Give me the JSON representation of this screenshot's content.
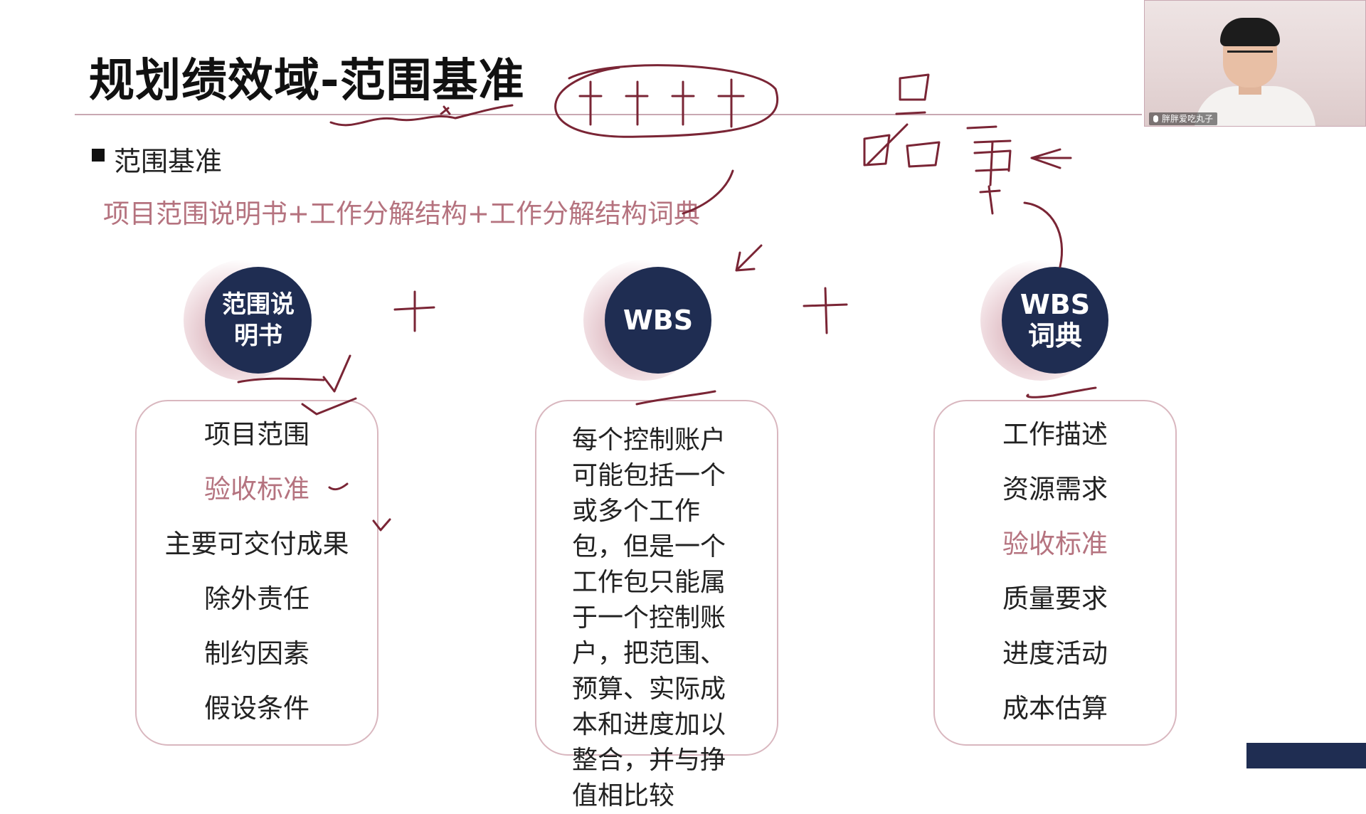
{
  "slide": {
    "title": "规划绩效域-范围基准",
    "bullet": "范围基准",
    "formula": "项目范围说明书+工作分解结构+工作分解结构词典"
  },
  "circles": {
    "scope_statement": "范围说\n明书",
    "wbs": "WBS",
    "wbs_dictionary": "WBS\n词典"
  },
  "cards": {
    "scope_statement": {
      "items": [
        "项目范围",
        "验收标准",
        "主要可交付成果",
        "除外责任",
        "制约因素",
        "假设条件"
      ]
    },
    "wbs": {
      "text": "每个控制账户可能包括一个或多个工作包，但是一个工作包只能属于一个控制账户，把范围、预算、实际成本和进度加以整合，并与挣值相比较"
    },
    "wbs_dictionary": {
      "items": [
        "工作描述",
        "资源需求",
        "验收标准",
        "质量要求",
        "进度活动",
        "成本估算"
      ]
    }
  },
  "webcam": {
    "name": "胖胖爱吃丸子"
  },
  "colors": {
    "circle": "#1f2d52",
    "highlight_text": "#b5737f",
    "ink": "#7a2535",
    "card_border": "#d9b7bf"
  }
}
